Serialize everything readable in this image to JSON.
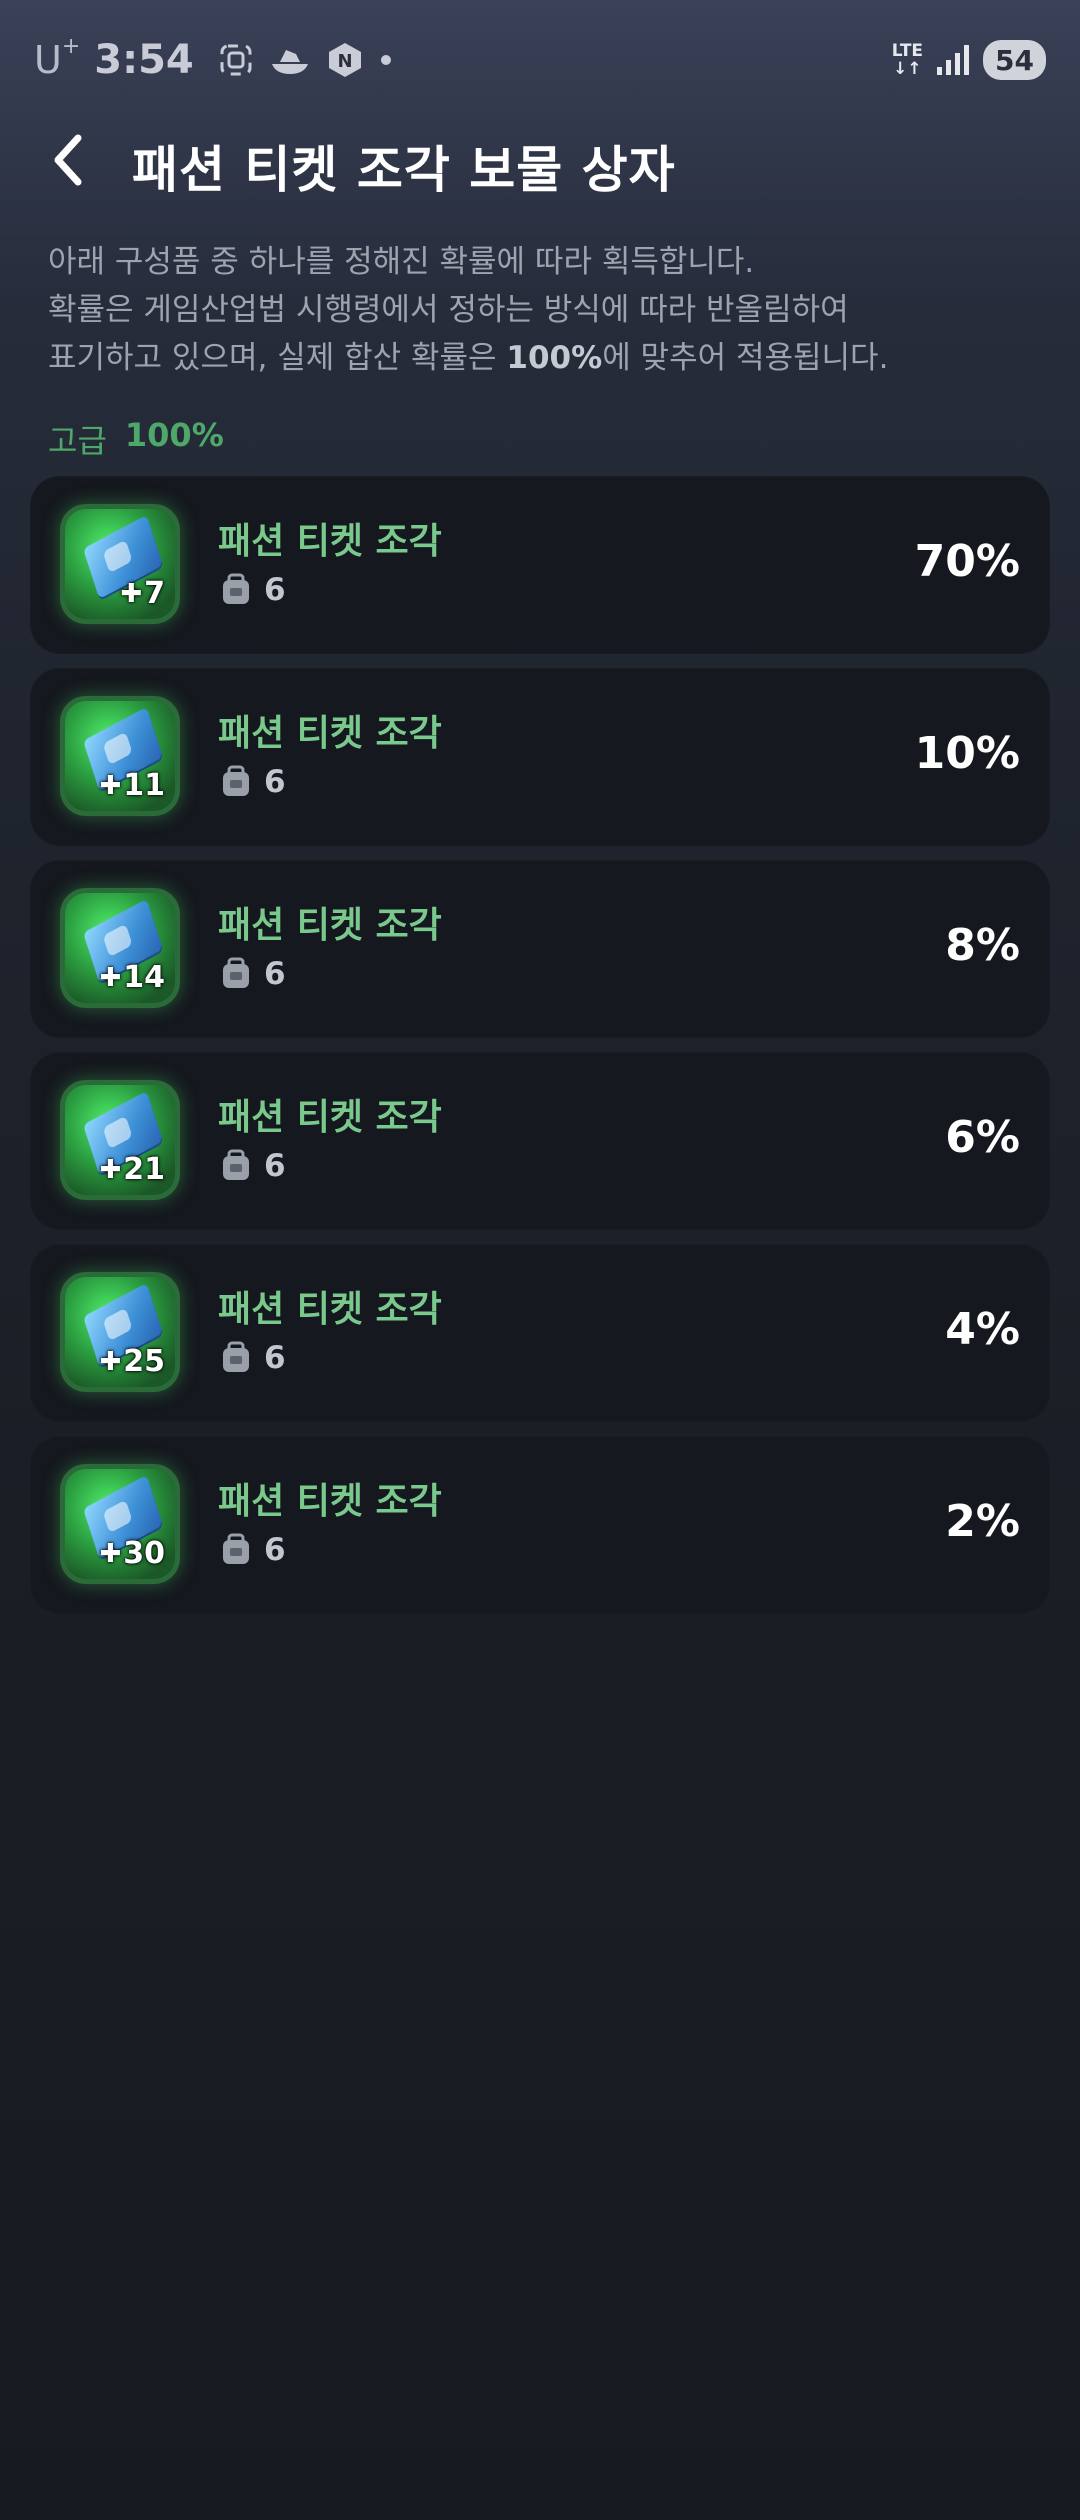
{
  "status_bar": {
    "carrier": "U",
    "carrier_sup": "+",
    "time": "3:54",
    "network": "LTE",
    "battery": "54",
    "icons": [
      "screenshot-icon",
      "boat-icon",
      "n-app-icon",
      "dot-icon",
      "signal-icon"
    ]
  },
  "header": {
    "title": "패션 티켓 조각 보물 상자"
  },
  "description": {
    "line1": "아래 구성품 중 하나를 정해진 확률에 따라 획득합니다.",
    "line2": "확률은 게임산업법 시행령에서 정하는 방식에 따라 반올림하여",
    "line3_pre": "표기하고 있으며, 실제 합산 확률은 ",
    "line3_bold": "100%",
    "line3_post": "에 맞추어 적용됩니다."
  },
  "grade": {
    "label": "고급",
    "percent": "100%"
  },
  "items": [
    {
      "name": "패션 티켓 조각",
      "qty": "7",
      "count": "6",
      "prob": "70%"
    },
    {
      "name": "패션 티켓 조각",
      "qty": "11",
      "count": "6",
      "prob": "10%"
    },
    {
      "name": "패션 티켓 조각",
      "qty": "14",
      "count": "6",
      "prob": "8%"
    },
    {
      "name": "패션 티켓 조각",
      "qty": "21",
      "count": "6",
      "prob": "6%"
    },
    {
      "name": "패션 티켓 조각",
      "qty": "25",
      "count": "6",
      "prob": "4%"
    },
    {
      "name": "패션 티켓 조각",
      "qty": "30",
      "count": "6",
      "prob": "2%"
    }
  ],
  "colors": {
    "accent_green": "#79c98d",
    "grade_green": "#4ea86a",
    "card_bg": "#15181e"
  }
}
